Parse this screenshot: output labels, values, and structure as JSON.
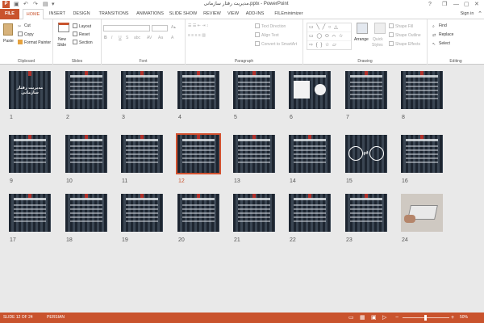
{
  "title": "مدیریت رفتار سازمانی.pptx - PowerPoint",
  "window_buttons": {
    "help": "?",
    "min": "—",
    "restore": "❐",
    "max": "▢",
    "close": "✕"
  },
  "qa_icons": [
    "save-icon",
    "undo-icon",
    "redo-icon",
    "start-icon",
    "customize-icon"
  ],
  "tabs": [
    "FILE",
    "HOME",
    "INSERT",
    "DESIGN",
    "TRANSITIONS",
    "ANIMATIONS",
    "SLIDE SHOW",
    "REVIEW",
    "VIEW",
    "ADD-INS",
    "FILEminimizer"
  ],
  "active_tab": "HOME",
  "sign_in": "Sign in",
  "ribbon": {
    "clipboard": {
      "label": "Clipboard",
      "paste": "Paste",
      "cut": "Cut",
      "copy": "Copy",
      "format_painter": "Format Painter"
    },
    "slides": {
      "label": "Slides",
      "new_slide": "New",
      "new_slide2": "Slide",
      "layout": "Layout",
      "reset": "Reset",
      "section": "Section"
    },
    "font": {
      "label": "Font",
      "font_name": "",
      "font_size": ""
    },
    "paragraph": {
      "label": "Paragraph",
      "text_direction": "Text Direction",
      "align_text": "Align Text",
      "convert_smartart": "Convert to SmartArt"
    },
    "drawing": {
      "label": "Drawing",
      "arrange": "Arrange",
      "quick_styles": "Quick",
      "quick_styles2": "Styles",
      "shape_fill": "Shape Fill",
      "shape_outline": "Shape Outline",
      "shape_effects": "Shape Effects"
    },
    "editing": {
      "label": "Editing",
      "find": "Find",
      "replace": "Replace",
      "select": "Select"
    }
  },
  "slides": [
    {
      "n": "1",
      "kind": "title",
      "title": "مدیریت رفتار سازمانی"
    },
    {
      "n": "2",
      "kind": "text"
    },
    {
      "n": "3",
      "kind": "text"
    },
    {
      "n": "4",
      "kind": "text"
    },
    {
      "n": "5",
      "kind": "text"
    },
    {
      "n": "6",
      "kind": "diagram"
    },
    {
      "n": "7",
      "kind": "text"
    },
    {
      "n": "8",
      "kind": "text"
    },
    {
      "n": "9",
      "kind": "text"
    },
    {
      "n": "10",
      "kind": "text"
    },
    {
      "n": "11",
      "kind": "text"
    },
    {
      "n": "12",
      "kind": "text"
    },
    {
      "n": "13",
      "kind": "text"
    },
    {
      "n": "14",
      "kind": "text"
    },
    {
      "n": "15",
      "kind": "arrows"
    },
    {
      "n": "16",
      "kind": "text"
    },
    {
      "n": "17",
      "kind": "text"
    },
    {
      "n": "18",
      "kind": "text"
    },
    {
      "n": "19",
      "kind": "text"
    },
    {
      "n": "20",
      "kind": "text"
    },
    {
      "n": "21",
      "kind": "text"
    },
    {
      "n": "22",
      "kind": "text"
    },
    {
      "n": "23",
      "kind": "text"
    },
    {
      "n": "24",
      "kind": "photo"
    }
  ],
  "selected_slide": "12",
  "status": {
    "slide": "SLIDE 12 OF 24",
    "language": "PERSIAN",
    "zoom": "50%"
  },
  "colors": {
    "accent": "#c9532d",
    "selection": "#d35230",
    "slide_bg": "#2f3742"
  }
}
